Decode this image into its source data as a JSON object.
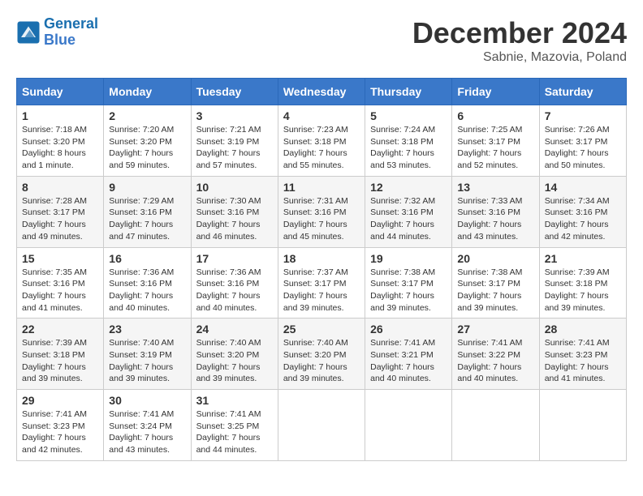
{
  "logo": {
    "line1": "General",
    "line2": "Blue"
  },
  "title": "December 2024",
  "subtitle": "Sabnie, Mazovia, Poland",
  "days_of_week": [
    "Sunday",
    "Monday",
    "Tuesday",
    "Wednesday",
    "Thursday",
    "Friday",
    "Saturday"
  ],
  "weeks": [
    [
      {
        "day": "1",
        "sunrise": "7:18 AM",
        "sunset": "3:20 PM",
        "daylight": "8 hours and 1 minute."
      },
      {
        "day": "2",
        "sunrise": "7:20 AM",
        "sunset": "3:20 PM",
        "daylight": "7 hours and 59 minutes."
      },
      {
        "day": "3",
        "sunrise": "7:21 AM",
        "sunset": "3:19 PM",
        "daylight": "7 hours and 57 minutes."
      },
      {
        "day": "4",
        "sunrise": "7:23 AM",
        "sunset": "3:18 PM",
        "daylight": "7 hours and 55 minutes."
      },
      {
        "day": "5",
        "sunrise": "7:24 AM",
        "sunset": "3:18 PM",
        "daylight": "7 hours and 53 minutes."
      },
      {
        "day": "6",
        "sunrise": "7:25 AM",
        "sunset": "3:17 PM",
        "daylight": "7 hours and 52 minutes."
      },
      {
        "day": "7",
        "sunrise": "7:26 AM",
        "sunset": "3:17 PM",
        "daylight": "7 hours and 50 minutes."
      }
    ],
    [
      {
        "day": "8",
        "sunrise": "7:28 AM",
        "sunset": "3:17 PM",
        "daylight": "7 hours and 49 minutes."
      },
      {
        "day": "9",
        "sunrise": "7:29 AM",
        "sunset": "3:16 PM",
        "daylight": "7 hours and 47 minutes."
      },
      {
        "day": "10",
        "sunrise": "7:30 AM",
        "sunset": "3:16 PM",
        "daylight": "7 hours and 46 minutes."
      },
      {
        "day": "11",
        "sunrise": "7:31 AM",
        "sunset": "3:16 PM",
        "daylight": "7 hours and 45 minutes."
      },
      {
        "day": "12",
        "sunrise": "7:32 AM",
        "sunset": "3:16 PM",
        "daylight": "7 hours and 44 minutes."
      },
      {
        "day": "13",
        "sunrise": "7:33 AM",
        "sunset": "3:16 PM",
        "daylight": "7 hours and 43 minutes."
      },
      {
        "day": "14",
        "sunrise": "7:34 AM",
        "sunset": "3:16 PM",
        "daylight": "7 hours and 42 minutes."
      }
    ],
    [
      {
        "day": "15",
        "sunrise": "7:35 AM",
        "sunset": "3:16 PM",
        "daylight": "7 hours and 41 minutes."
      },
      {
        "day": "16",
        "sunrise": "7:36 AM",
        "sunset": "3:16 PM",
        "daylight": "7 hours and 40 minutes."
      },
      {
        "day": "17",
        "sunrise": "7:36 AM",
        "sunset": "3:16 PM",
        "daylight": "7 hours and 40 minutes."
      },
      {
        "day": "18",
        "sunrise": "7:37 AM",
        "sunset": "3:17 PM",
        "daylight": "7 hours and 39 minutes."
      },
      {
        "day": "19",
        "sunrise": "7:38 AM",
        "sunset": "3:17 PM",
        "daylight": "7 hours and 39 minutes."
      },
      {
        "day": "20",
        "sunrise": "7:38 AM",
        "sunset": "3:17 PM",
        "daylight": "7 hours and 39 minutes."
      },
      {
        "day": "21",
        "sunrise": "7:39 AM",
        "sunset": "3:18 PM",
        "daylight": "7 hours and 39 minutes."
      }
    ],
    [
      {
        "day": "22",
        "sunrise": "7:39 AM",
        "sunset": "3:18 PM",
        "daylight": "7 hours and 39 minutes."
      },
      {
        "day": "23",
        "sunrise": "7:40 AM",
        "sunset": "3:19 PM",
        "daylight": "7 hours and 39 minutes."
      },
      {
        "day": "24",
        "sunrise": "7:40 AM",
        "sunset": "3:20 PM",
        "daylight": "7 hours and 39 minutes."
      },
      {
        "day": "25",
        "sunrise": "7:40 AM",
        "sunset": "3:20 PM",
        "daylight": "7 hours and 39 minutes."
      },
      {
        "day": "26",
        "sunrise": "7:41 AM",
        "sunset": "3:21 PM",
        "daylight": "7 hours and 40 minutes."
      },
      {
        "day": "27",
        "sunrise": "7:41 AM",
        "sunset": "3:22 PM",
        "daylight": "7 hours and 40 minutes."
      },
      {
        "day": "28",
        "sunrise": "7:41 AM",
        "sunset": "3:23 PM",
        "daylight": "7 hours and 41 minutes."
      }
    ],
    [
      {
        "day": "29",
        "sunrise": "7:41 AM",
        "sunset": "3:23 PM",
        "daylight": "7 hours and 42 minutes."
      },
      {
        "day": "30",
        "sunrise": "7:41 AM",
        "sunset": "3:24 PM",
        "daylight": "7 hours and 43 minutes."
      },
      {
        "day": "31",
        "sunrise": "7:41 AM",
        "sunset": "3:25 PM",
        "daylight": "7 hours and 44 minutes."
      },
      null,
      null,
      null,
      null
    ]
  ],
  "labels": {
    "sunrise": "Sunrise:",
    "sunset": "Sunset:",
    "daylight": "Daylight:"
  }
}
